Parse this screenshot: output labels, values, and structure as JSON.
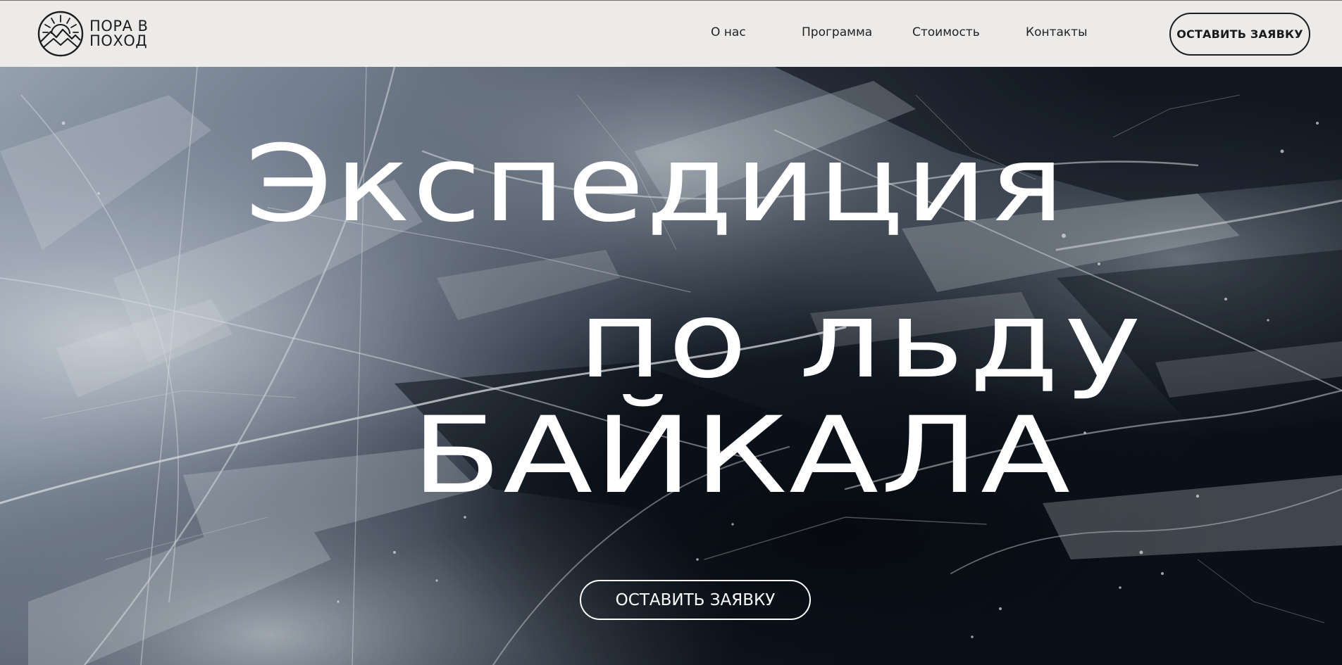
{
  "header": {
    "logo": {
      "line1": "ПОРА В",
      "line2": "ПОХОД",
      "icon": "sun-mountains-logo-icon"
    },
    "nav": [
      {
        "label": "О нас"
      },
      {
        "label": "Программа"
      },
      {
        "label": "Стоимость"
      },
      {
        "label": "Контакты"
      }
    ],
    "cta_label": "ОСТАВИТЬ ЗАЯВКУ"
  },
  "hero": {
    "title_line1": "Экспедиция",
    "title_line2": "по льду",
    "title_line3": "БАЙКАЛА",
    "cta_label": "ОСТАВИТЬ ЗАЯВКУ"
  },
  "colors": {
    "header_bg": "#ecebea",
    "header_text": "#222222",
    "hero_text": "#ffffff",
    "ice_dark": "#0d131b",
    "ice_light": "#c9d3df"
  }
}
